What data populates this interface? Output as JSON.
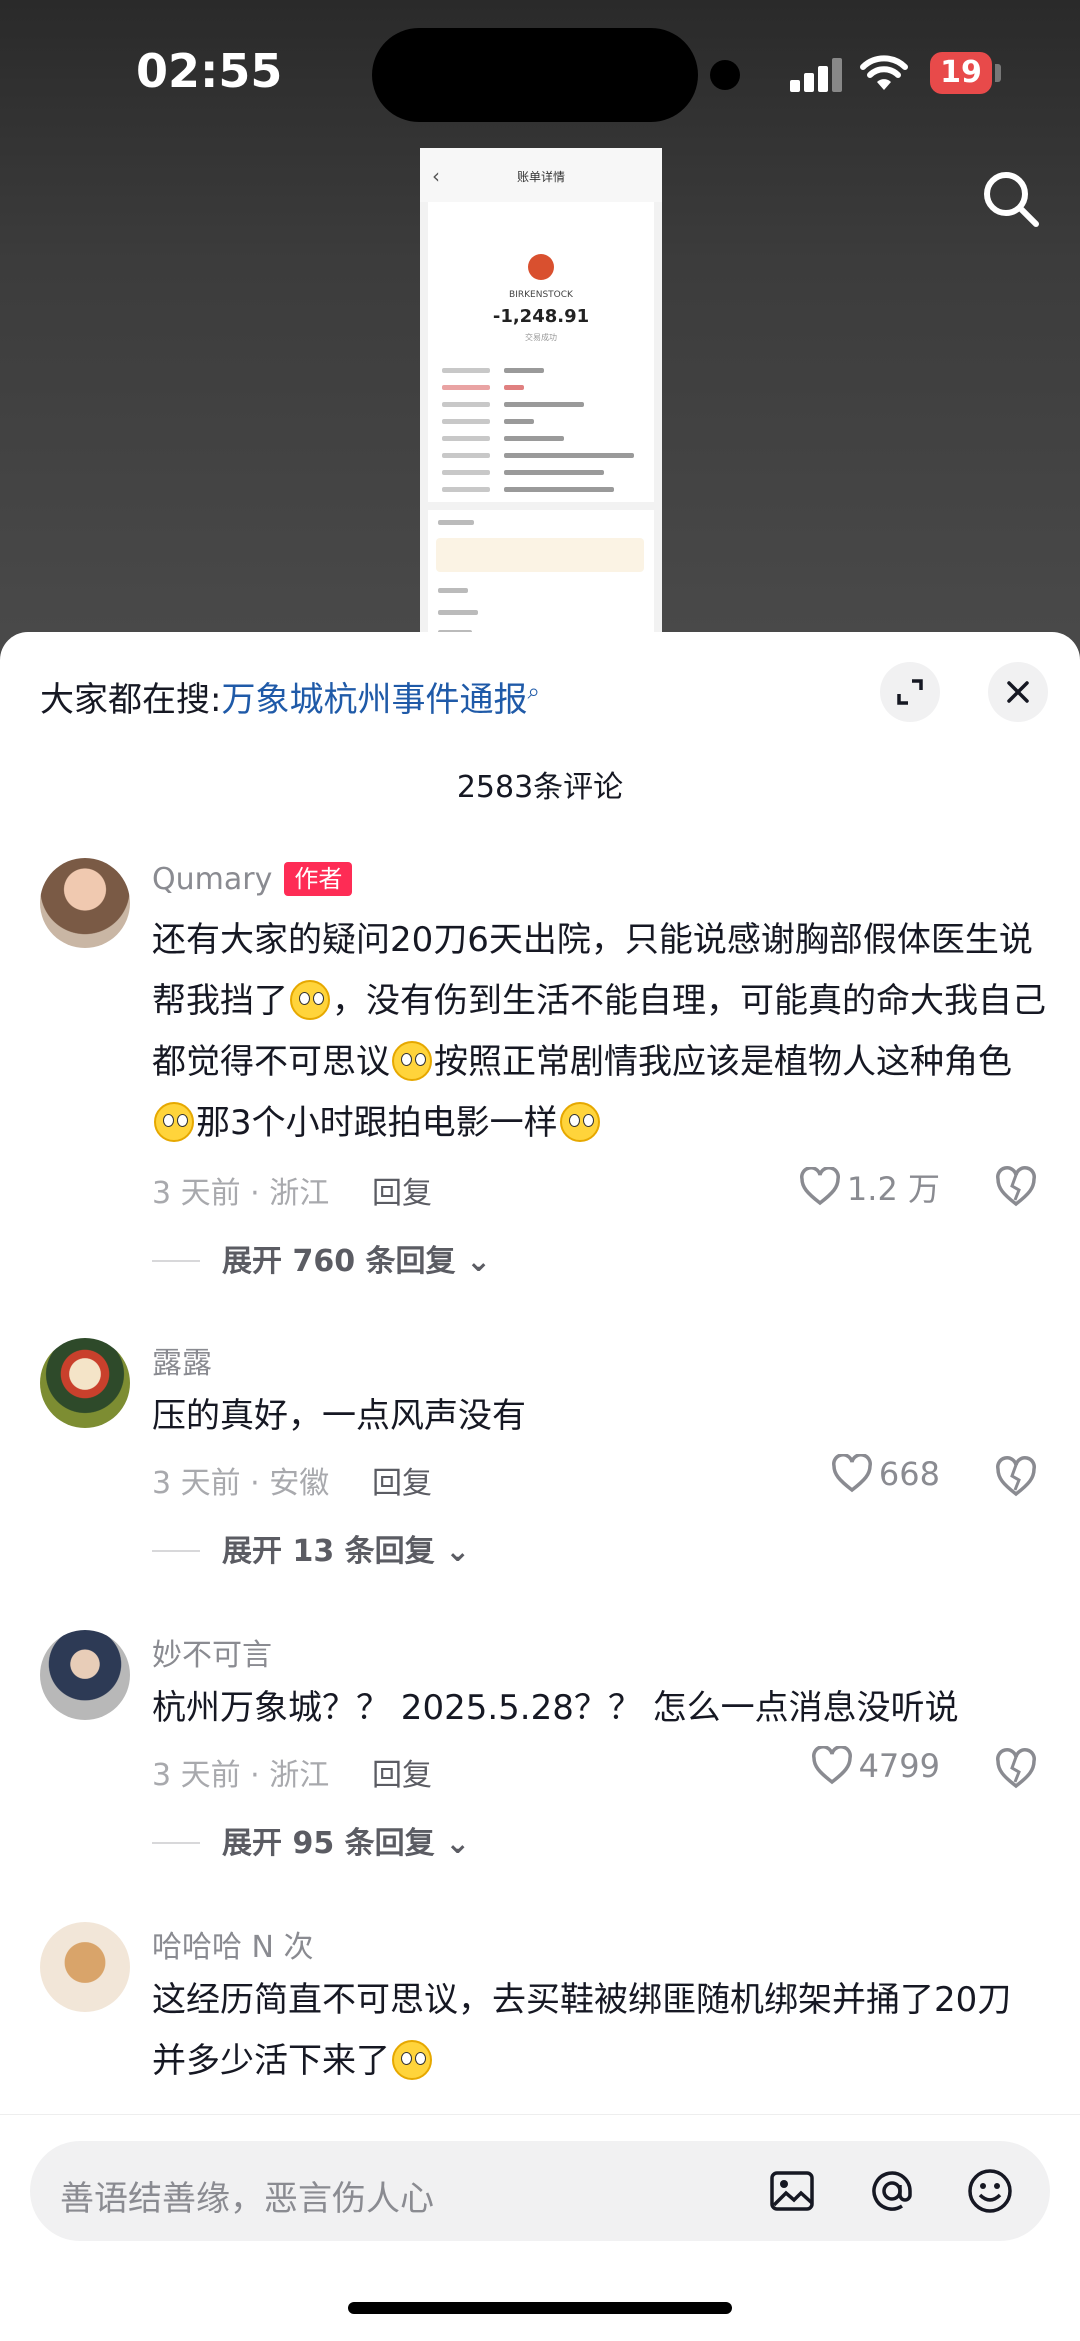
{
  "status_bar": {
    "time": "02:55",
    "battery": "19"
  },
  "receipt": {
    "title": "账单详情",
    "brand": "BIRKENSTOCK",
    "amount": "-1,248.91",
    "status": "交易成功"
  },
  "sheet": {
    "hot_search_prefix": "大家都在搜:",
    "hot_search_keyword": "万象城杭州事件通报",
    "comment_count": "2583条评论"
  },
  "comments": [
    {
      "user": "Qumary",
      "tag": "作者",
      "segments": [
        "还有大家的疑问20刀6天出院，只能说感谢胸部假体医生说帮我挡了",
        "，没有伤到生活不能自理，可能真的命大我自己都觉得不可思议",
        "按照正常剧情我应该是植物人这种角色",
        "那3个小时跟拍电影一样",
        ""
      ],
      "meta": "3 天前 · 浙江",
      "reply": "回复",
      "likes": "1.2 万",
      "expand": "展开 760 条回复"
    },
    {
      "user": "露露",
      "segments": [
        "压的真好，一点风声没有"
      ],
      "meta": "3 天前 · 安徽",
      "reply": "回复",
      "likes": "668",
      "expand": "展开 13 条回复"
    },
    {
      "user": "妙不可言",
      "segments": [
        "杭州万象城？？ 2025.5.28？？ 怎么一点消息没听说"
      ],
      "meta": "3 天前 · 浙江",
      "reply": "回复",
      "likes": "4799",
      "expand": "展开 95 条回复"
    },
    {
      "user": "哈哈哈 N 次",
      "segments": [
        "这经历简直不可思议，去买鞋被绑匪随机绑架并捅了20刀并多少活下来了",
        ""
      ]
    }
  ],
  "input": {
    "placeholder": "善语结善缘，恶言伤人心"
  },
  "icons": [
    "search-icon",
    "expand-icon",
    "close-icon",
    "heart-icon",
    "dislike-icon",
    "image-icon",
    "at-icon",
    "emoji-icon"
  ],
  "colors": {
    "accent": "#fe2c55",
    "link": "#1f5aa8"
  }
}
